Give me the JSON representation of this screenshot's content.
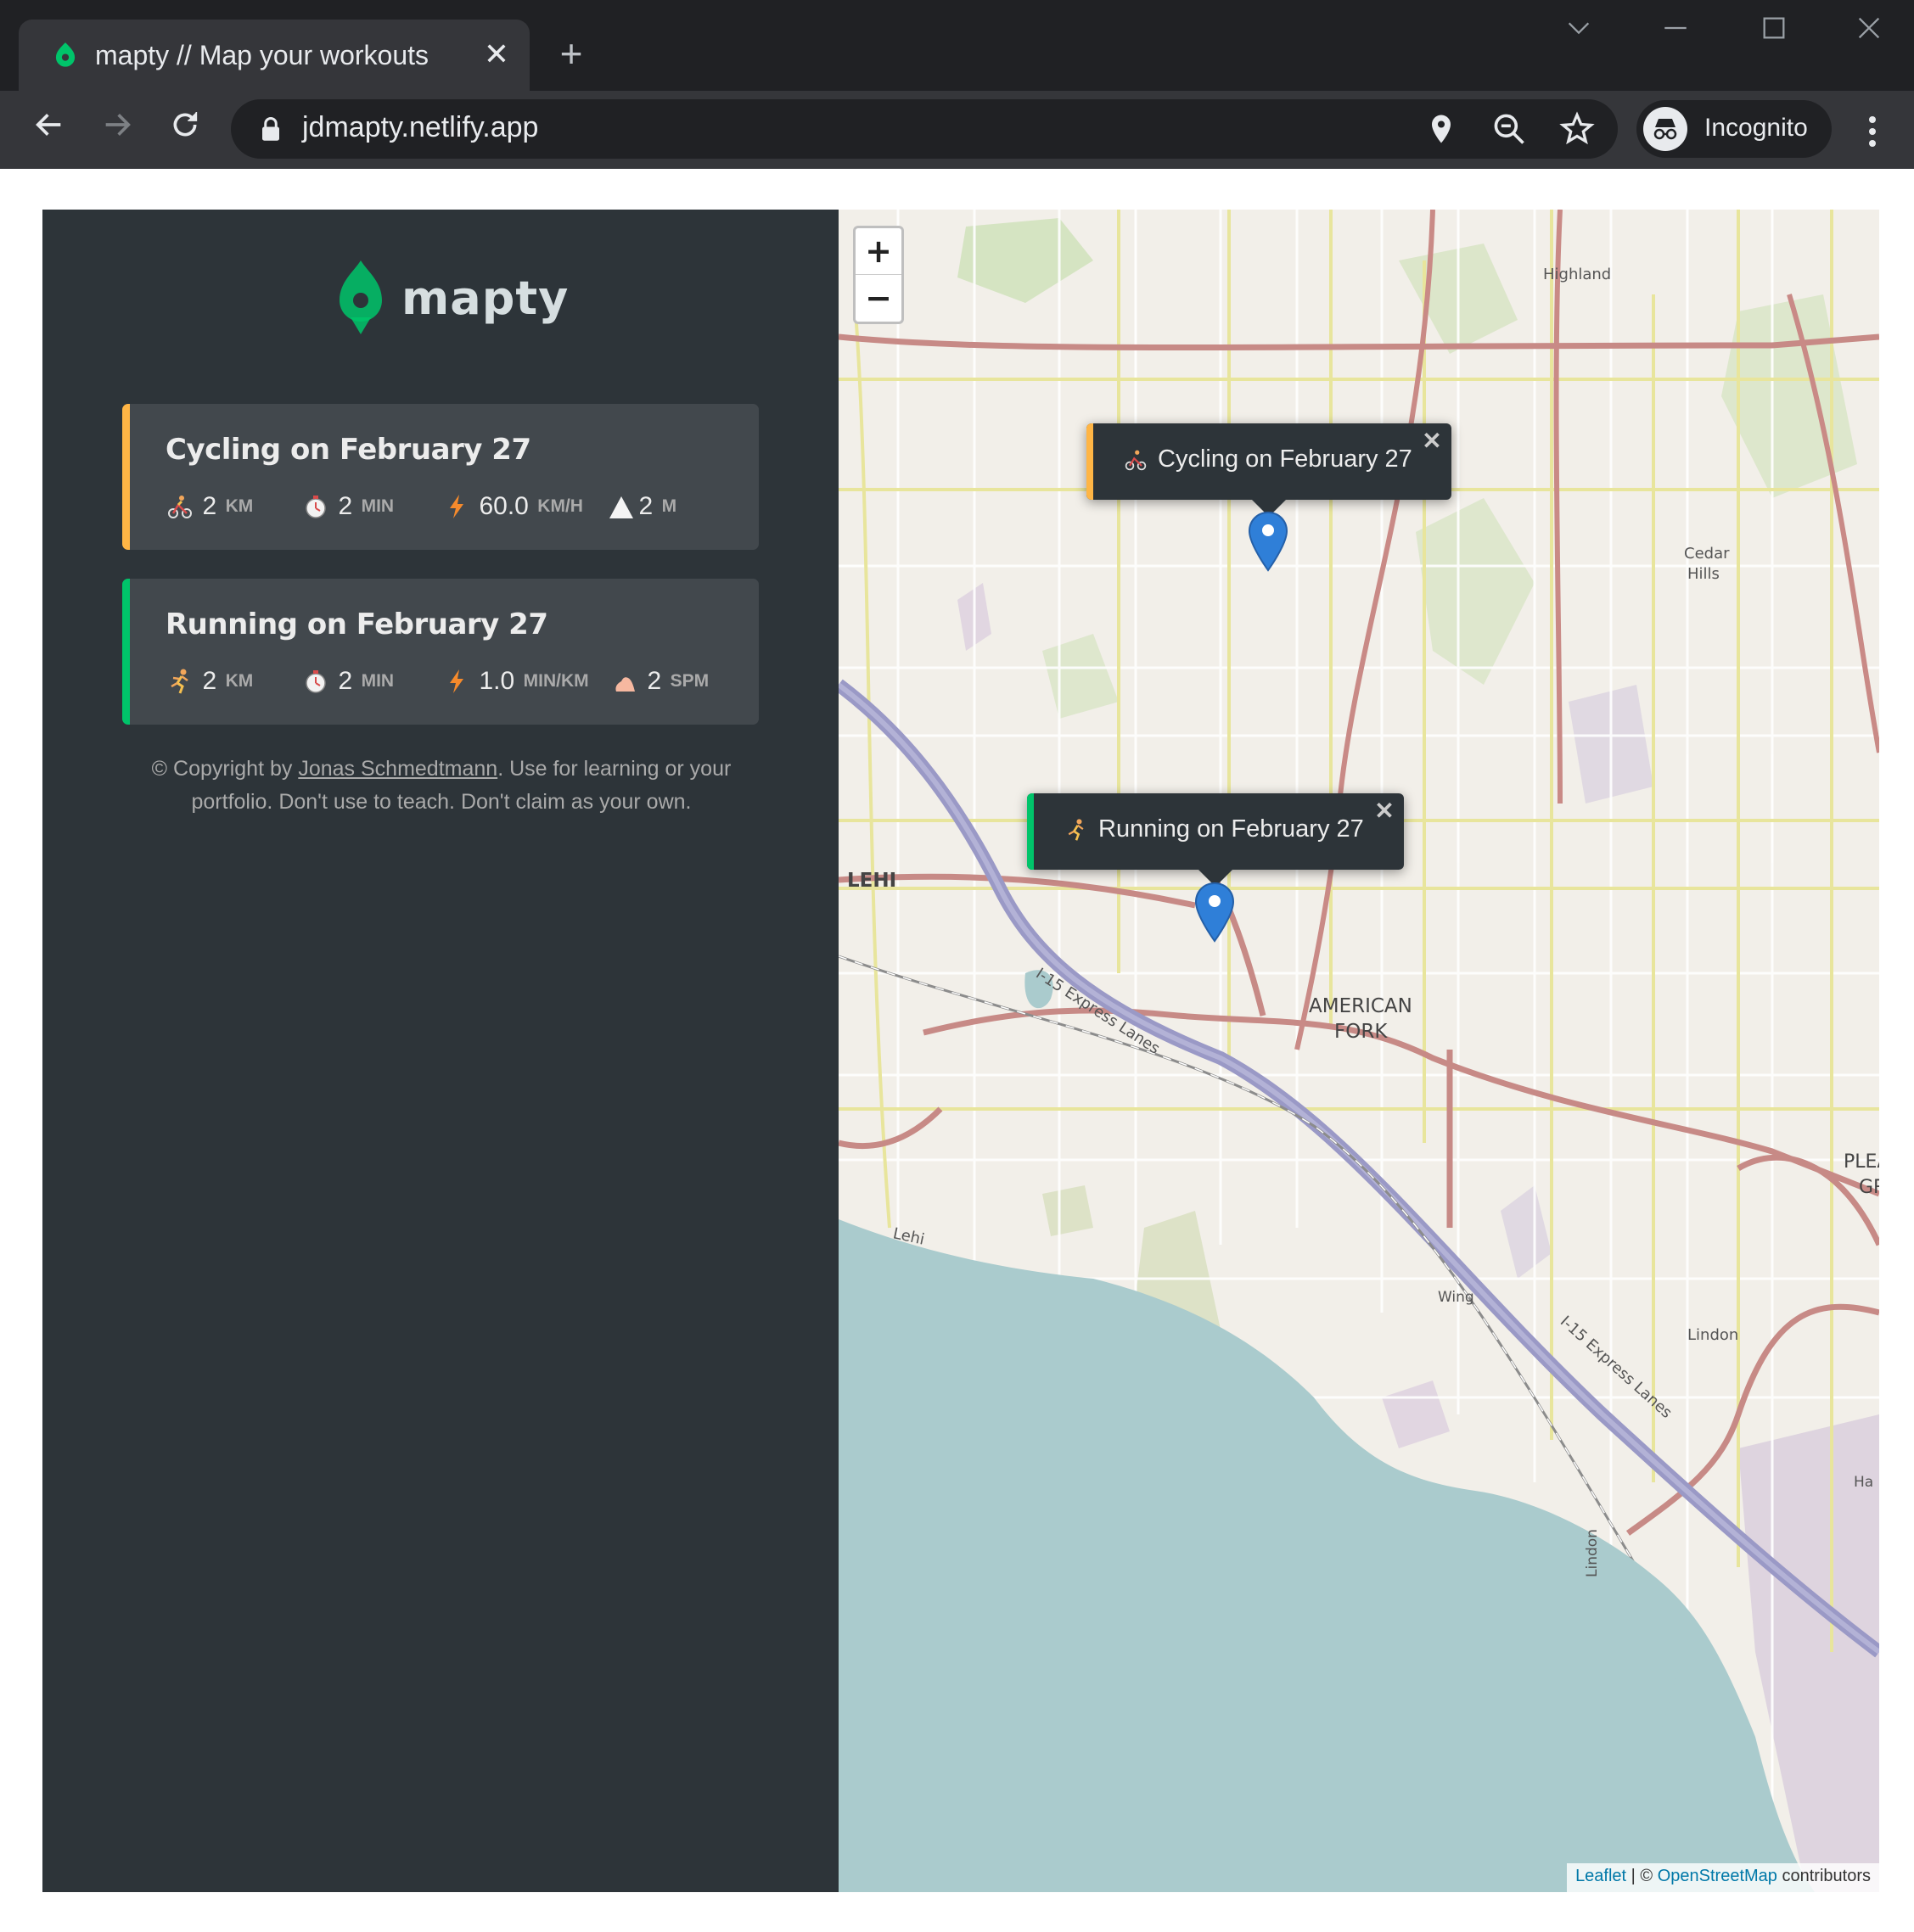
{
  "browser": {
    "tab_title": "mapty // Map your workouts",
    "tab_close": "✕",
    "new_tab": "+",
    "url": "jdmapty.netlify.app",
    "incognito_label": "Incognito"
  },
  "app": {
    "logo_text": "mapty",
    "colors": {
      "sidebar_bg": "#2d3439",
      "card_bg": "#42484d",
      "cycling_accent": "#ffb545",
      "running_accent": "#00c46a",
      "brand_green": "#00c46a"
    }
  },
  "workouts": [
    {
      "type": "cycling",
      "title": "Cycling on February 27",
      "details": [
        {
          "icon": "cyclist-icon",
          "value": "2",
          "unit": "KM"
        },
        {
          "icon": "stopwatch-icon",
          "value": "2",
          "unit": "MIN"
        },
        {
          "icon": "lightning-icon",
          "value": "60.0",
          "unit": "KM/H"
        },
        {
          "icon": "mountain-icon",
          "value": "2",
          "unit": "M"
        }
      ]
    },
    {
      "type": "running",
      "title": "Running on February 27",
      "details": [
        {
          "icon": "runner-icon",
          "value": "2",
          "unit": "KM"
        },
        {
          "icon": "stopwatch-icon",
          "value": "2",
          "unit": "MIN"
        },
        {
          "icon": "lightning-icon",
          "value": "1.0",
          "unit": "MIN/KM"
        },
        {
          "icon": "foot-icon",
          "value": "2",
          "unit": "SPM"
        }
      ]
    }
  ],
  "copyright": {
    "prefix": "© Copyright by ",
    "author": "Jonas Schmedtmann",
    "suffix": ". Use for learning or your portfolio. Don't use to teach. Don't claim as your own."
  },
  "map": {
    "zoom_in": "+",
    "zoom_out": "−",
    "popups": [
      {
        "text": "Cycling on February 27",
        "close": "✕"
      },
      {
        "text": "Running on February 27",
        "close": "✕"
      }
    ],
    "labels": {
      "lehi": "LEHI",
      "american": "AMERICAN",
      "fork": "FORK",
      "highland": "Highland",
      "cedar": "Cedar",
      "hills": "Hills",
      "lindon": "Lindon",
      "lehi_small": "Lehi",
      "wing": "Wing",
      "express1": "I-15 Express Lanes",
      "express2": "I-15 Express Lanes",
      "plea": "PLEA",
      "gr": "GR",
      "ha": "Ha",
      "lindon_road": "Lindon"
    },
    "attribution": {
      "leaflet": "Leaflet",
      "sep": " | © ",
      "osm": "OpenStreetMap",
      "contrib": " contributors"
    }
  }
}
